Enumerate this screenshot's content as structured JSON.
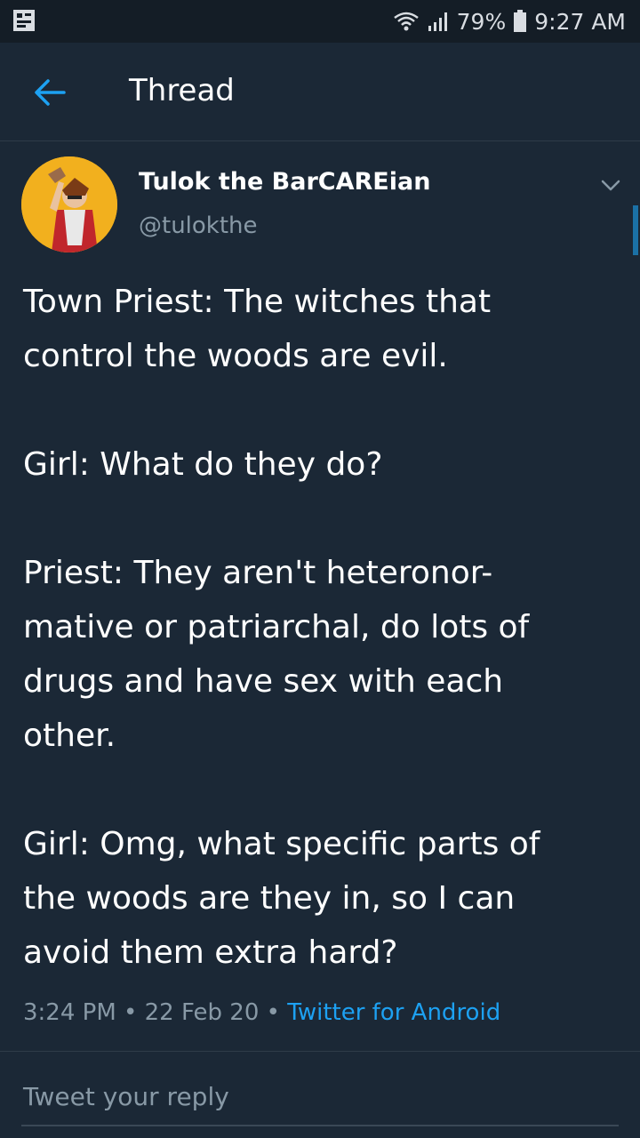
{
  "status_bar": {
    "battery": "79%",
    "time": "9:27 AM"
  },
  "header": {
    "title": "Thread"
  },
  "tweet": {
    "author_name": "Tulok the BarCAREian",
    "author_handle": "@tulokthe",
    "text": "Town Priest: The witches that\ncontrol the woods are evil.\n\nGirl: What do they do?\n\nPriest: They aren't heteronor-\nmative or patriarchal, do lots of\ndrugs and have sex with each\nother.\n\nGirl: Omg, what specific parts of\nthe woods are they in, so I can\navoid them extra hard?",
    "time": "3:24 PM",
    "date": "22 Feb 20",
    "source": "Twitter for Android"
  },
  "reply": {
    "placeholder": "Tweet your reply"
  },
  "colors": {
    "background": "#1b2836",
    "accent": "#1da1f2",
    "secondary_text": "#8899a6"
  }
}
